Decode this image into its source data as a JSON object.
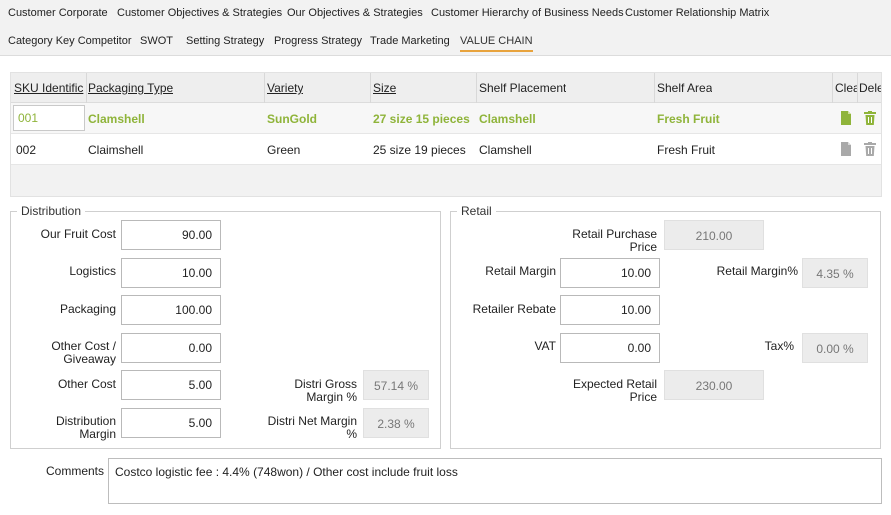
{
  "tabs_row1": [
    "Customer Corporate",
    "Customer Objectives & Strategies",
    "Our Objectives & Strategies",
    "Customer Hierarchy of Business Needs",
    "Customer Relationship Matrix"
  ],
  "tabs_row2": [
    "Category Key Competitor",
    "SWOT",
    "Setting Strategy",
    "Progress Strategy",
    "Trade Marketing",
    "VALUE CHAIN"
  ],
  "active_tab": "VALUE CHAIN",
  "grid": {
    "columns": [
      "SKU Identific",
      "Packaging Type",
      "Variety",
      "Size",
      "Shelf Placement",
      "Shelf Area",
      "Clea",
      "Dele"
    ],
    "rows": [
      {
        "sku": "001",
        "packaging": "Clamshell",
        "variety": "SunGold",
        "size": "27 size 15 pieces",
        "placement": "Clamshell",
        "area": "Fresh Fruit"
      },
      {
        "sku": "002",
        "packaging": "Claimshell",
        "variety": "Green",
        "size": "25 size 19 pieces",
        "placement": "Clamshell",
        "area": "Fresh Fruit"
      }
    ]
  },
  "distribution": {
    "title": "Distribution",
    "our_fruit_cost_label": "Our Fruit Cost",
    "our_fruit_cost": "90.00",
    "logistics_label": "Logistics",
    "logistics": "10.00",
    "packaging_label": "Packaging",
    "packaging": "100.00",
    "other_cost_giveaway_label": "Other Cost / Giveaway",
    "other_cost_giveaway": "0.00",
    "other_cost_label": "Other Cost",
    "other_cost": "5.00",
    "distribution_margin_label": "Distribution Margin",
    "distribution_margin": "5.00",
    "gross_margin_label": "Distri Gross Margin %",
    "gross_margin": "57.14 %",
    "net_margin_label": "Distri Net Margin %",
    "net_margin": "2.38 %"
  },
  "retail": {
    "title": "Retail",
    "purchase_price_label": "Retail Purchase Price",
    "purchase_price": "210.00",
    "margin_label": "Retail Margin",
    "margin": "10.00",
    "margin_pct_label": "Retail Margin%",
    "margin_pct": "4.35 %",
    "rebate_label": "Retailer Rebate",
    "rebate": "10.00",
    "vat_label": "VAT",
    "vat": "0.00",
    "tax_label": "Tax%",
    "tax": "0.00 %",
    "expected_price_label": "Expected Retail Price",
    "expected_price": "230.00"
  },
  "comments": {
    "label": "Comments",
    "value": "Costco logistic fee  : 4.4% (748won) / Other cost include fruit loss"
  },
  "colors": {
    "accent": "#8fb43a",
    "tab_underline": "#e8a33d"
  }
}
